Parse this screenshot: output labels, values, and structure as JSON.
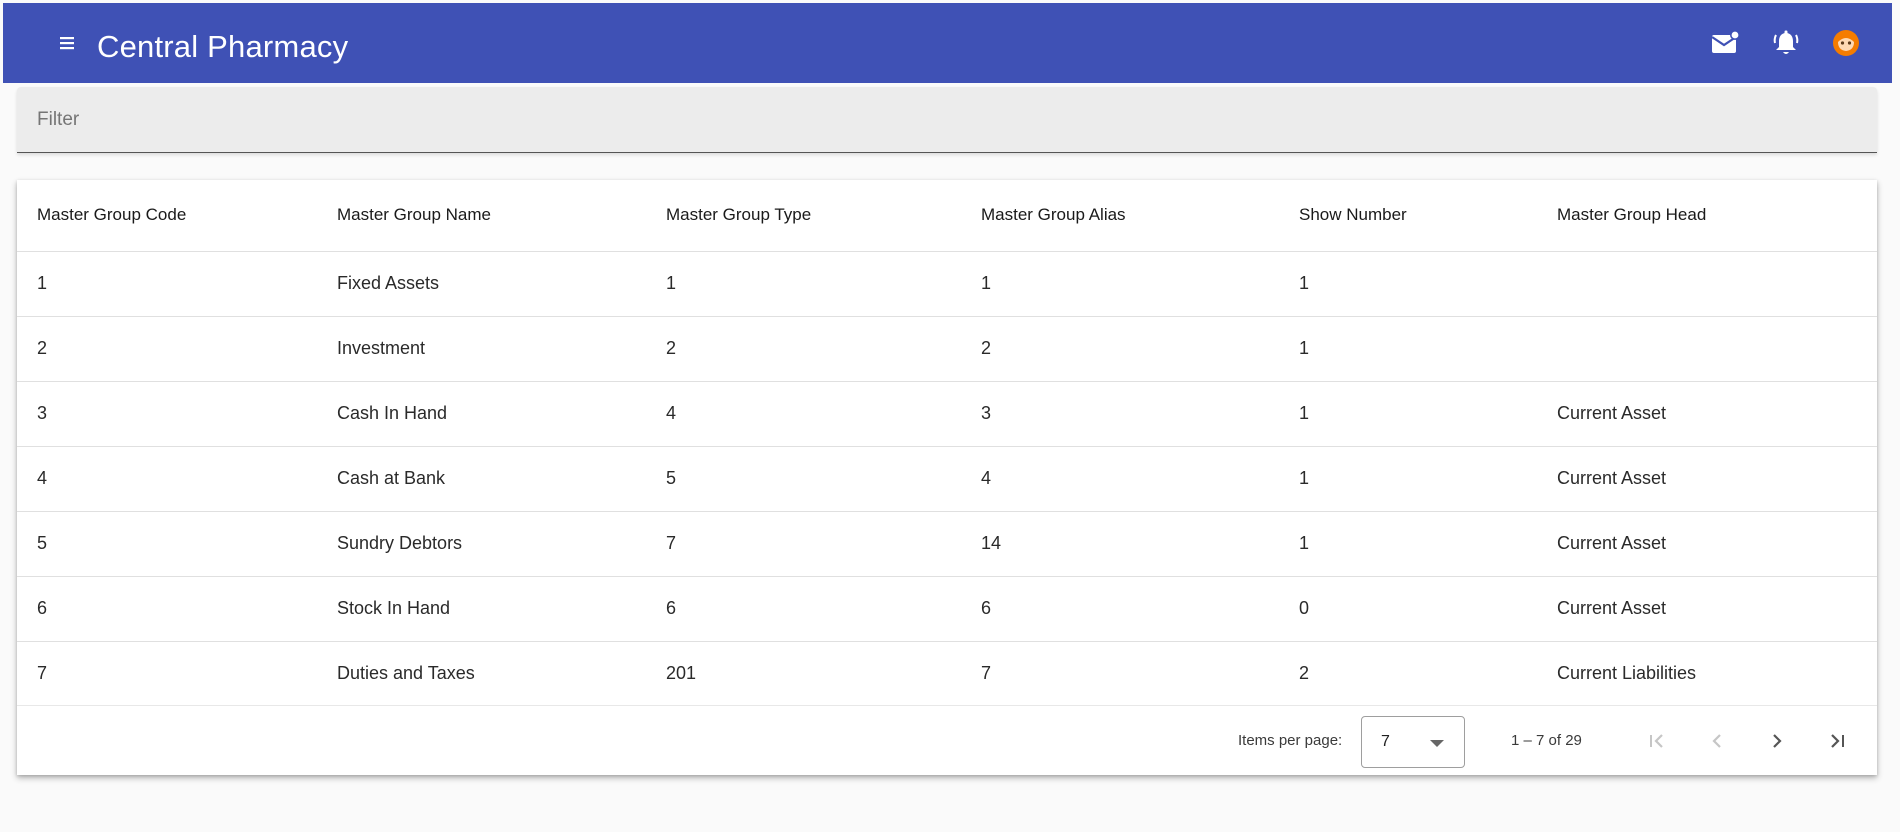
{
  "header": {
    "title": "Central Pharmacy",
    "menu_icon": "menu-icon",
    "mail_icon": "mail-icon",
    "bell_icon": "notification-bell-icon",
    "avatar_icon": "avatar-icon",
    "colors": {
      "toolbar": "#3f51b5",
      "avatar": "#f57c00"
    }
  },
  "filter": {
    "placeholder": "Filter",
    "value": ""
  },
  "table": {
    "columns": [
      "Master Group Code",
      "Master Group Name",
      "Master Group Type",
      "Master Group Alias",
      "Show Number",
      "Master Group Head"
    ],
    "rows": [
      [
        "1",
        "Fixed Assets",
        "1",
        "1",
        "1",
        ""
      ],
      [
        "2",
        "Investment",
        "2",
        "2",
        "1",
        ""
      ],
      [
        "3",
        "Cash In Hand",
        "4",
        "3",
        "1",
        "Current Asset"
      ],
      [
        "4",
        "Cash at Bank",
        "5",
        "4",
        "1",
        "Current Asset"
      ],
      [
        "5",
        "Sundry Debtors",
        "7",
        "14",
        "1",
        "Current Asset"
      ],
      [
        "6",
        "Stock In Hand",
        "6",
        "6",
        "0",
        "Current Asset"
      ],
      [
        "7",
        "Duties and Taxes",
        "201",
        "7",
        "2",
        "Current Liabilities"
      ]
    ]
  },
  "paginator": {
    "items_per_page_label": "Items per page:",
    "page_size": "7",
    "range_label": "1 – 7 of 29",
    "first_enabled": false,
    "prev_enabled": false,
    "next_enabled": true,
    "last_enabled": true
  }
}
